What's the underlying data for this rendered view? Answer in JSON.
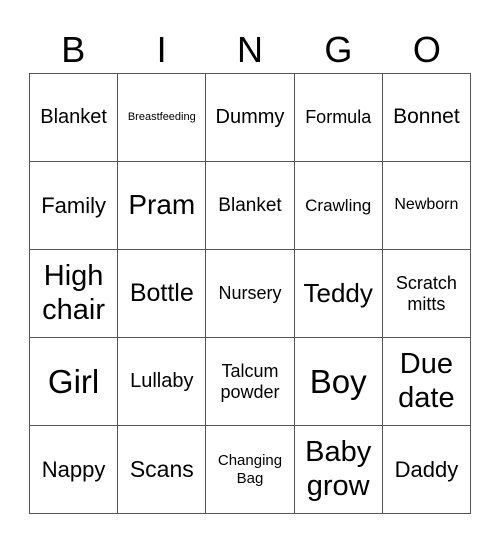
{
  "header": {
    "letters": [
      "B",
      "I",
      "N",
      "G",
      "O"
    ]
  },
  "board": {
    "rows": [
      [
        {
          "text": "Blanket",
          "size": 20
        },
        {
          "text": "Breastfeeding",
          "size": 11
        },
        {
          "text": "Dummy",
          "size": 20
        },
        {
          "text": "Formula",
          "size": 18
        },
        {
          "text": "Bonnet",
          "size": 21
        }
      ],
      [
        {
          "text": "Family",
          "size": 22
        },
        {
          "text": "Pram",
          "size": 28
        },
        {
          "text": "Blanket",
          "size": 19
        },
        {
          "text": "Crawling",
          "size": 17
        },
        {
          "text": "Newborn",
          "size": 16
        }
      ],
      [
        {
          "text": "High chair",
          "size": 29
        },
        {
          "text": "Bottle",
          "size": 25
        },
        {
          "text": "Nursery",
          "size": 18
        },
        {
          "text": "Teddy",
          "size": 26
        },
        {
          "text": "Scratch mitts",
          "size": 18
        }
      ],
      [
        {
          "text": "Girl",
          "size": 33
        },
        {
          "text": "Lullaby",
          "size": 20
        },
        {
          "text": "Talcum powder",
          "size": 18
        },
        {
          "text": "Boy",
          "size": 33
        },
        {
          "text": "Due date",
          "size": 29
        }
      ],
      [
        {
          "text": "Nappy",
          "size": 22
        },
        {
          "text": "Scans",
          "size": 23
        },
        {
          "text": "Changing Bag",
          "size": 15
        },
        {
          "text": "Baby grow",
          "size": 29
        },
        {
          "text": "Daddy",
          "size": 22
        }
      ]
    ]
  }
}
